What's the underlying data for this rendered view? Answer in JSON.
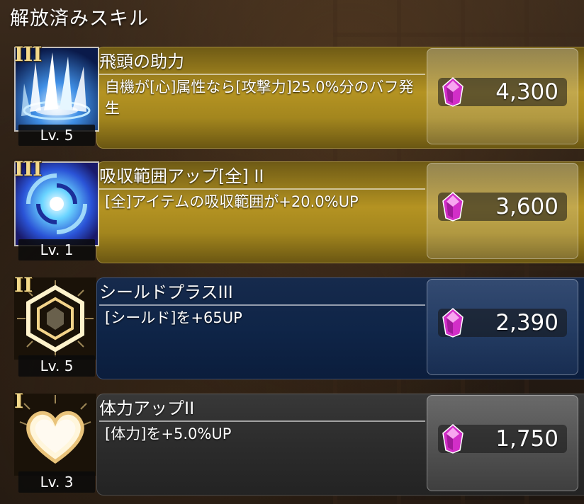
{
  "section_title": "解放済みスキル",
  "skills": [
    {
      "rank": "III",
      "name": "飛頭の助力",
      "description": "自機が[心]属性なら[攻撃力]25.0%分のバフ発生",
      "level": "Lv. 5",
      "cost": "4,300",
      "style": "gold",
      "icon": "blue-spikes-burst-icon"
    },
    {
      "rank": "III",
      "name": "吸収範囲アップ[全] II",
      "description": "[全]アイテムの吸収範囲が+20.0%UP",
      "level": "Lv. 1",
      "cost": "3,600",
      "style": "gold",
      "icon": "blue-vortex-icon"
    },
    {
      "rank": "II",
      "name": "シールドプラスIII",
      "description": "[シールド]を+65UP",
      "level": "Lv. 5",
      "cost": "2,390",
      "style": "blue",
      "icon": "hexagon-shield-icon"
    },
    {
      "rank": "I",
      "name": "体力アップII",
      "description": "[体力]を+5.0%UP",
      "level": "Lv. 3",
      "cost": "1,750",
      "style": "dark",
      "icon": "heart-icon"
    }
  ],
  "colors": {
    "gold_panel": "#b49322",
    "blue_panel": "#0f2548",
    "dark_panel": "#2c2c2c",
    "gem": "#e23ad6"
  }
}
